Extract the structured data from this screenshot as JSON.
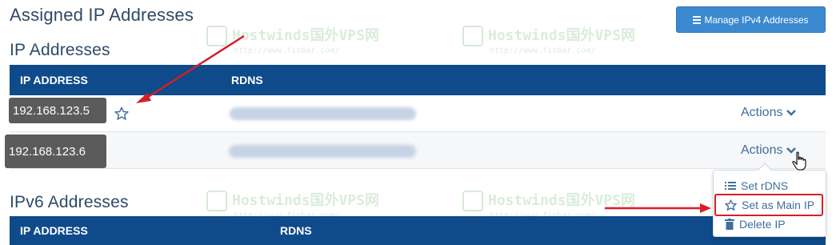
{
  "headings": {
    "assigned": "Assigned IP Addresses",
    "ip_section": "IP Addresses",
    "ipv6_section": "IPv6 Addresses"
  },
  "manage_button": {
    "label": "Manage IPv4 Addresses",
    "icon": "list-icon"
  },
  "ip_table": {
    "columns": [
      "IP ADDRESS",
      "RDNS"
    ],
    "rows": [
      {
        "ip": "192.168.123.5",
        "rdns": "",
        "actions_label": "Actions",
        "main_ip_icon": "star-outline-icon"
      },
      {
        "ip": "192.168.123.6",
        "rdns": "",
        "actions_label": "Actions"
      }
    ]
  },
  "ipv6_table": {
    "columns": [
      "IP ADDRESS",
      "RDNS"
    ]
  },
  "actions_menu": {
    "items": [
      {
        "label": "Set rDNS",
        "icon": "list-icon"
      },
      {
        "label": "Set as Main IP",
        "icon": "star-outline-icon",
        "highlighted": true
      },
      {
        "label": "Delete IP",
        "icon": "trash-icon"
      }
    ]
  },
  "watermark": {
    "brand": "Hostwinds国外VPS网",
    "url": "http://www.fixbar.com/"
  },
  "colors": {
    "table_header": "#0f4a8a",
    "button": "#3b8ad0",
    "link": "#3f6f9e",
    "annotation": "#d61f26"
  }
}
